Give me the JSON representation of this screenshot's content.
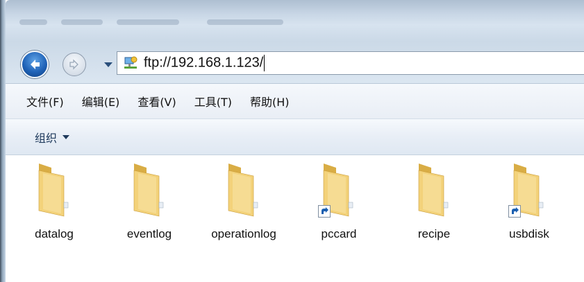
{
  "navigation": {
    "address": "ftp://192.168.1.123/"
  },
  "menu": {
    "items": [
      "文件(F)",
      "编辑(E)",
      "查看(V)",
      "工具(T)",
      "帮助(H)"
    ]
  },
  "toolbar": {
    "organize_label": "组织"
  },
  "files": [
    {
      "name": "datalog",
      "icon": "folder-icon",
      "shortcut": false
    },
    {
      "name": "eventlog",
      "icon": "folder-icon",
      "shortcut": false
    },
    {
      "name": "operationlog",
      "icon": "folder-icon",
      "shortcut": false
    },
    {
      "name": "pccard",
      "icon": "folder-icon",
      "shortcut": true
    },
    {
      "name": "recipe",
      "icon": "folder-icon",
      "shortcut": false
    },
    {
      "name": "usbdisk",
      "icon": "folder-icon",
      "shortcut": true
    }
  ],
  "colors": {
    "folder": "#f3d27a",
    "folder_dark": "#d9ad45",
    "accent": "#2063b8"
  }
}
